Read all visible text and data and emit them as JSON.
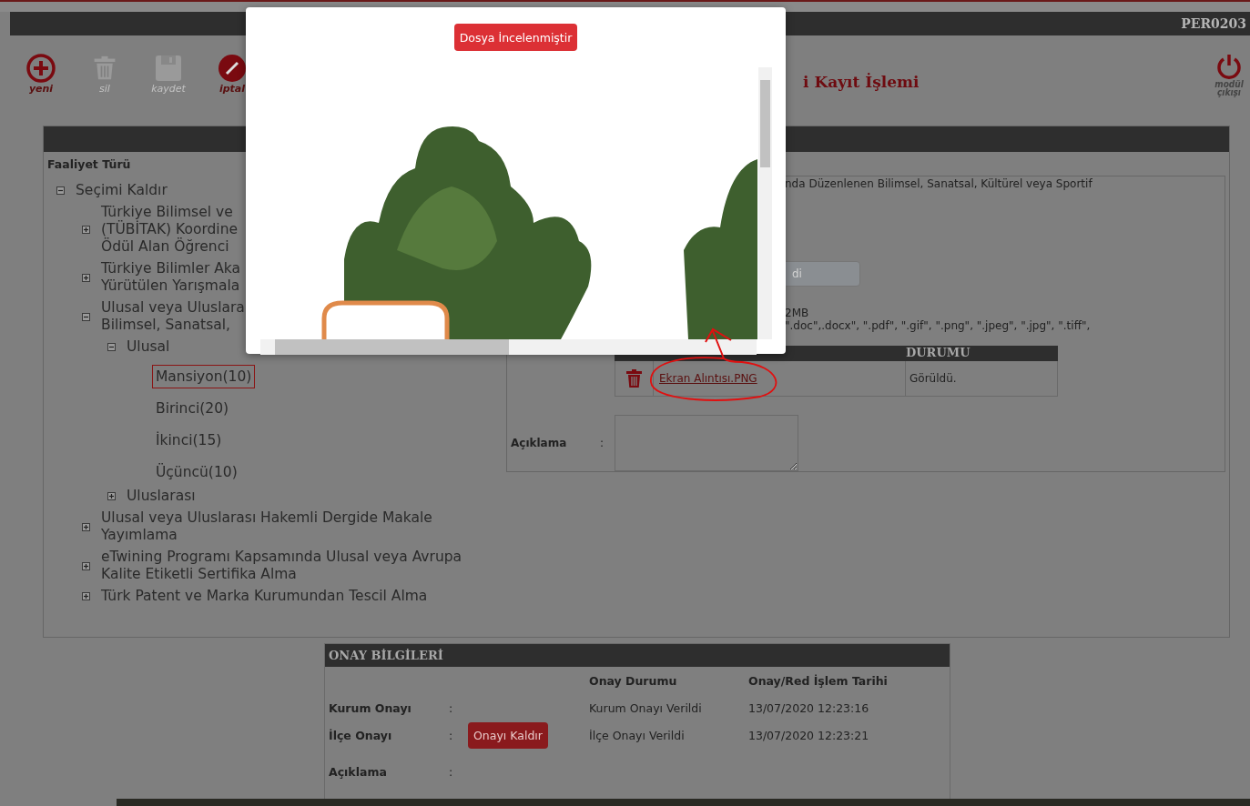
{
  "header": {
    "code": "PER0203"
  },
  "toolbar": [
    {
      "label": "yeni",
      "disabled": false
    },
    {
      "label": "sil",
      "disabled": true
    },
    {
      "label": "kaydet",
      "disabled": true
    },
    {
      "label": "iptal",
      "disabled": false
    }
  ],
  "page_title": "i Kayıt İşlemi",
  "exit_button": {
    "label": "modül çıkışı"
  },
  "tree": {
    "heading": "Faaliyet Türü",
    "items": [
      {
        "lines": [
          "Seçimi Kaldır"
        ],
        "expanded": true,
        "children": [
          {
            "lines": [
              "Türkiye Bilimsel ve",
              "(TÜBİTAK) Koordine",
              "Ödül Alan Öğrenci"
            ],
            "expanded": false
          },
          {
            "lines": [
              "Türkiye Bilimler Aka",
              "Yürütülen Yarışmala"
            ],
            "expanded": false
          },
          {
            "lines": [
              "Ulusal veya Uluslara",
              "Bilimsel, Sanatsal,"
            ],
            "expanded": true,
            "children": [
              {
                "lines": [
                  "Ulusal"
                ],
                "expanded": true,
                "children": [
                  {
                    "lines": [
                      "Mansiyon(10)"
                    ],
                    "selected": true
                  },
                  {
                    "lines": [
                      "Birinci(20)"
                    ],
                    "selected": false
                  },
                  {
                    "lines": [
                      "İkinci(15)"
                    ],
                    "selected": false
                  },
                  {
                    "lines": [
                      "Üçüncü(10)"
                    ],
                    "selected": false
                  }
                ]
              },
              {
                "lines": [
                  "Uluslarası"
                ],
                "expanded": false
              }
            ]
          },
          {
            "lines": [
              "Ulusal veya Uluslarası Hakemli Dergide Makale",
              "Yayımlama"
            ],
            "expanded": false
          },
          {
            "lines": [
              "eTwining Programı Kapsamında Ulusal veya Avrupa",
              "Kalite Etiketli Sertifika Alma"
            ],
            "expanded": false
          },
          {
            "lines": [
              "Türk Patent ve Marka Kurumundan Tescil Alma"
            ],
            "expanded": false
          }
        ]
      }
    ]
  },
  "form": {
    "description": "nda Düzenlenen Bilimsel, Sanatsal, Kültürel veya Sportif",
    "upload_button": "di",
    "size_note": "2MB",
    "extensions_note": "\".doc\",.docx\", \".pdf\", \".gif\", \".png\", \".jpeg\", \".jpg\", \".tiff\",",
    "files_table": {
      "columns": [
        "DURUMU"
      ],
      "rows": [
        {
          "file": "Ekran Alıntısı.PNG",
          "status": "Görüldü."
        }
      ]
    },
    "note_label": "Açıklama",
    "note_colon": ":"
  },
  "approval": {
    "title": "ONAY BİLGİLERİ",
    "columns": [
      "Onay Durumu",
      "Onay/Red İşlem Tarihi"
    ],
    "rows": [
      {
        "label": "Kurum Onayı",
        "colon": ":",
        "status": "Kurum Onayı Verildi",
        "date": "13/07/2020 12:23:16"
      },
      {
        "label": "İlçe Onayı",
        "colon": ":",
        "action": "Onayı Kaldır",
        "status": "İlçe Onayı Verildi",
        "date": "13/07/2020 12:23:21"
      }
    ],
    "note_label": "Açıklama",
    "note_colon": ":"
  },
  "modal": {
    "button": "Dosya İncelenmiştir"
  }
}
